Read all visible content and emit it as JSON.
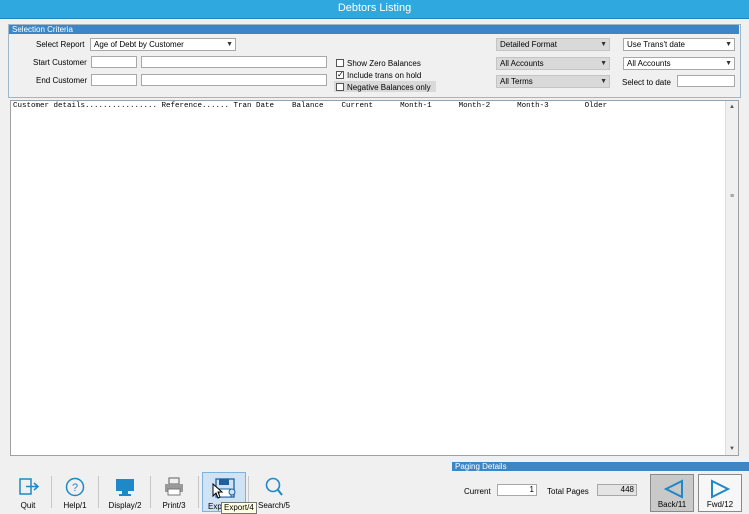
{
  "window": {
    "title": "Debtors Listing"
  },
  "selection": {
    "header": "Selection Criteria",
    "select_report_label": "Select Report",
    "select_report_value": "Age of Debt by Customer",
    "start_customer_label": "Start Customer",
    "start_customer_value": "",
    "end_customer_label": "End Customer",
    "end_customer_value": "",
    "show_zero_label": "Show Zero Balances",
    "include_hold_label": "Include trans on hold",
    "negative_only_label": "Negative Balances only",
    "show_zero_checked": false,
    "include_hold_checked": true,
    "negative_only_checked": false,
    "format_value": "Detailed Format",
    "accounts1_value": "All Accounts",
    "terms_value": "All Terms",
    "date_mode_value": "Use Trans't date",
    "accounts2_value": "All Accounts",
    "select_to_date_label": "Select to date",
    "select_to_date_value": ""
  },
  "list": {
    "header": "Customer details................ Reference...... Tran Date    Balance    Current      Month-1      Month-2      Month-3        Older"
  },
  "toolbar": {
    "quit": "Quit",
    "help": "Help/1",
    "display": "Display/2",
    "print": "Print/3",
    "export": "Exp",
    "search": "Search/5",
    "tooltip": "Export/4"
  },
  "paging": {
    "header": "Paging Details",
    "current_label": "Current",
    "current_value": "1",
    "total_label": "Total Pages",
    "total_value": "448",
    "back_label": "Back/11",
    "fwd_label": "Fwd/12"
  },
  "colors": {
    "titlebar": "#2ea8df",
    "panel_header": "#3d86c6",
    "icon_blue": "#1e88c8"
  }
}
